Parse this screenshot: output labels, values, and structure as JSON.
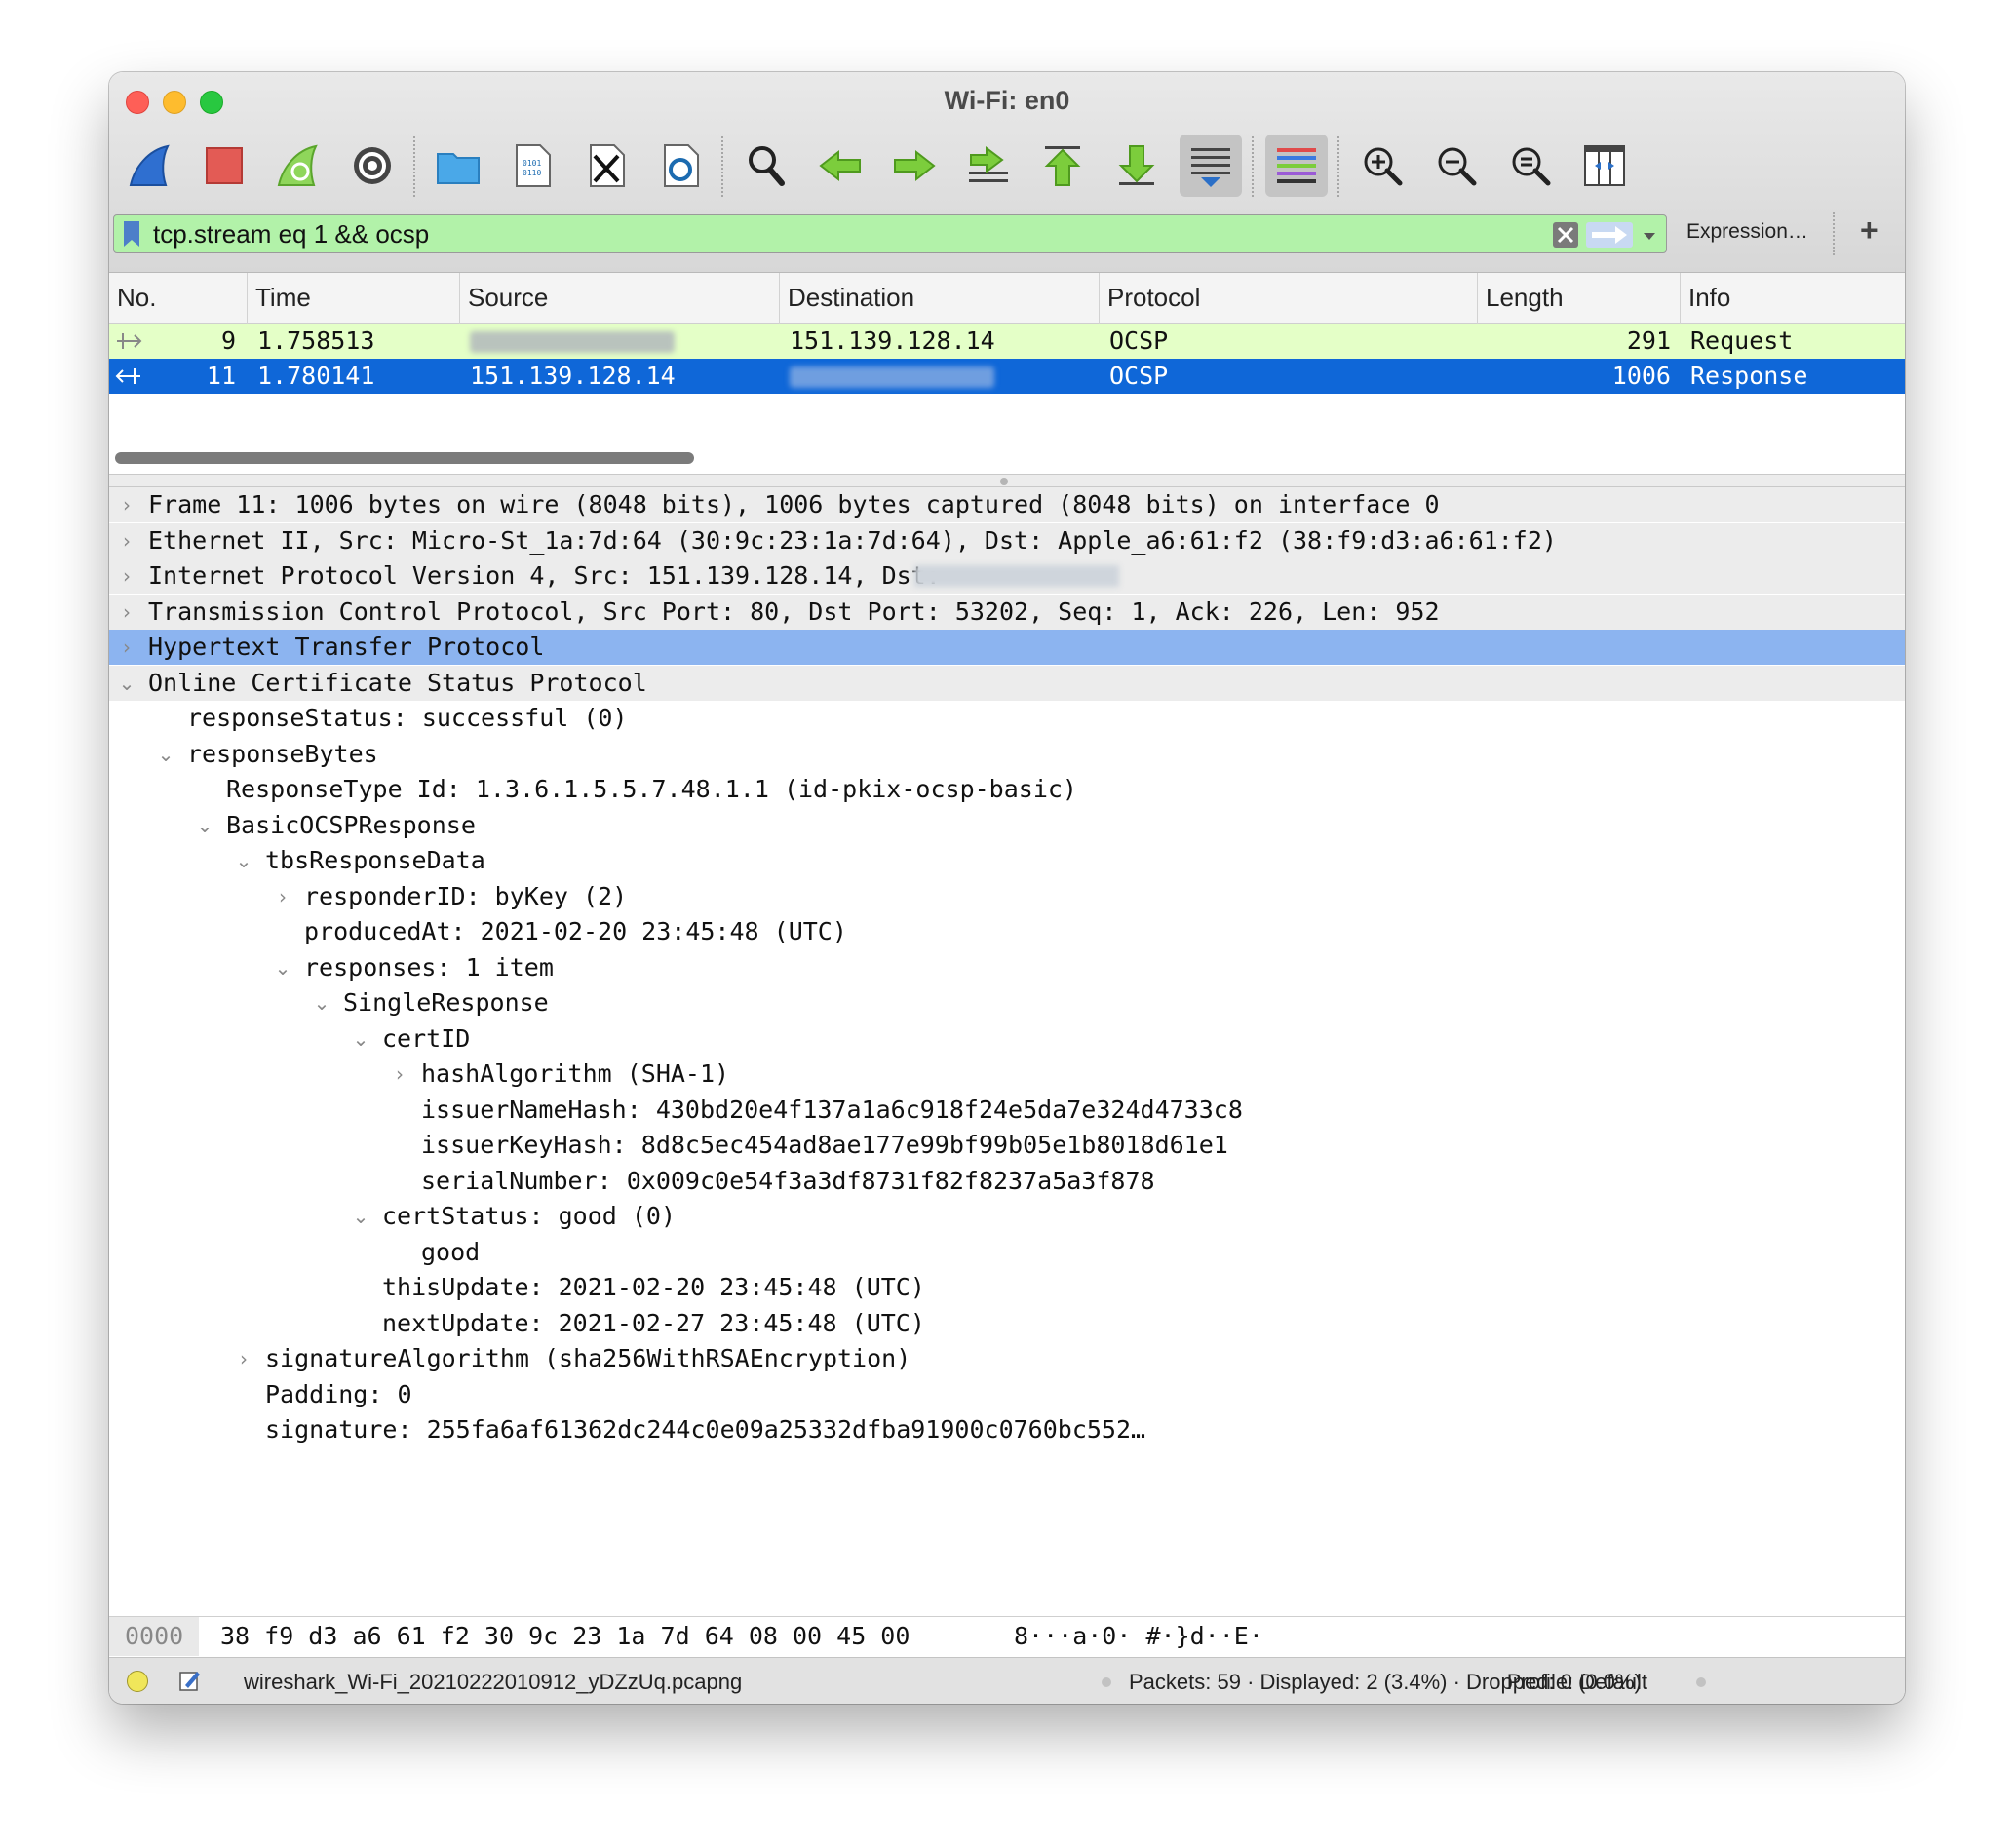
{
  "window": {
    "title": "Wi-Fi: en0"
  },
  "toolbar": {
    "buttons": [
      {
        "name": "start-capture",
        "icon": "shark-fin-icon"
      },
      {
        "name": "stop-capture",
        "icon": "stop-icon"
      },
      {
        "name": "restart-capture",
        "icon": "restart-icon"
      },
      {
        "name": "capture-options",
        "icon": "gear-icon"
      },
      {
        "name": "open-file",
        "icon": "folder-icon"
      },
      {
        "name": "save-file",
        "icon": "file-icon"
      },
      {
        "name": "close-file",
        "icon": "close-file-icon"
      },
      {
        "name": "reload-file",
        "icon": "reload-icon"
      },
      {
        "name": "find-packet",
        "icon": "search-icon"
      },
      {
        "name": "go-back",
        "icon": "arrow-left-icon"
      },
      {
        "name": "go-forward",
        "icon": "arrow-right-icon"
      },
      {
        "name": "go-to-packet",
        "icon": "go-to-icon"
      },
      {
        "name": "go-first",
        "icon": "arrow-up-icon"
      },
      {
        "name": "go-last",
        "icon": "arrow-down-icon"
      },
      {
        "name": "auto-scroll",
        "icon": "autoscroll-icon"
      },
      {
        "name": "colorize",
        "icon": "colorize-icon"
      },
      {
        "name": "zoom-in",
        "icon": "zoom-in-icon"
      },
      {
        "name": "zoom-out",
        "icon": "zoom-out-icon"
      },
      {
        "name": "normal-size",
        "icon": "zoom-reset-icon"
      },
      {
        "name": "resize-columns",
        "icon": "resize-columns-icon"
      }
    ]
  },
  "filter": {
    "value": "tcp.stream eq 1 && ocsp",
    "expression_label": "Expression…",
    "add_label": "+"
  },
  "packet_list": {
    "columns": [
      "No.",
      "Time",
      "Source",
      "Destination",
      "Protocol",
      "Length",
      "Info"
    ],
    "rows": [
      {
        "no": "9",
        "time": "1.758513",
        "source": "",
        "destination": "151.139.128.14",
        "protocol": "OCSP",
        "length": "291",
        "info": "Request"
      },
      {
        "no": "11",
        "time": "1.780141",
        "source": "151.139.128.14",
        "destination": "",
        "protocol": "OCSP",
        "length": "1006",
        "info": "Response"
      }
    ]
  },
  "details": {
    "rows": [
      {
        "text": "Frame 11: 1006 bytes on wire (8048 bits), 1006 bytes captured (8048 bits) on interface 0"
      },
      {
        "text": "Ethernet II, Src: Micro-St_1a:7d:64 (30:9c:23:1a:7d:64), Dst: Apple_a6:61:f2 (38:f9:d3:a6:61:f2)"
      },
      {
        "text": "Internet Protocol Version 4, Src: 151.139.128.14, Dst:"
      },
      {
        "text": "Transmission Control Protocol, Src Port: 80, Dst Port: 53202, Seq: 1, Ack: 226, Len: 952"
      },
      {
        "text": "Hypertext Transfer Protocol"
      },
      {
        "text": "Online Certificate Status Protocol"
      },
      {
        "text": "responseStatus: successful (0)"
      },
      {
        "text": "responseBytes"
      },
      {
        "text": "ResponseType Id: 1.3.6.1.5.5.7.48.1.1 (id-pkix-ocsp-basic)"
      },
      {
        "text": "BasicOCSPResponse"
      },
      {
        "text": "tbsResponseData"
      },
      {
        "text": "responderID: byKey (2)"
      },
      {
        "text": "producedAt: 2021-02-20 23:45:48 (UTC)"
      },
      {
        "text": "responses: 1 item"
      },
      {
        "text": "SingleResponse"
      },
      {
        "text": "certID"
      },
      {
        "text": "hashAlgorithm (SHA-1)"
      },
      {
        "text": "issuerNameHash: 430bd20e4f137a1a6c918f24e5da7e324d4733c8"
      },
      {
        "text": "issuerKeyHash: 8d8c5ec454ad8ae177e99bf99b05e1b8018d61e1"
      },
      {
        "text": "serialNumber: 0x009c0e54f3a3df8731f82f8237a5a3f878"
      },
      {
        "text": "certStatus: good (0)"
      },
      {
        "text": "good"
      },
      {
        "text": "thisUpdate: 2021-02-20 23:45:48 (UTC)"
      },
      {
        "text": "nextUpdate: 2021-02-27 23:45:48 (UTC)"
      },
      {
        "text": "signatureAlgorithm (sha256WithRSAEncryption)"
      },
      {
        "text": "Padding: 0"
      },
      {
        "text": "signature: 255fa6af61362dc244c0e09a25332dfba91900c0760bc552…"
      }
    ]
  },
  "hex": {
    "offset": "0000",
    "bytes": "38 f9 d3 a6 61 f2 30 9c  23 1a 7d 64 08 00 45 00",
    "ascii": "8···a·0· #·}d··E·"
  },
  "status": {
    "file": "wireshark_Wi-Fi_20210222010912_yDZzUq.pcapng",
    "packets": "Packets: 59 · Displayed: 2 (3.4%) · Dropped: 0 (0.0%)",
    "profile": "Profile: Default"
  }
}
